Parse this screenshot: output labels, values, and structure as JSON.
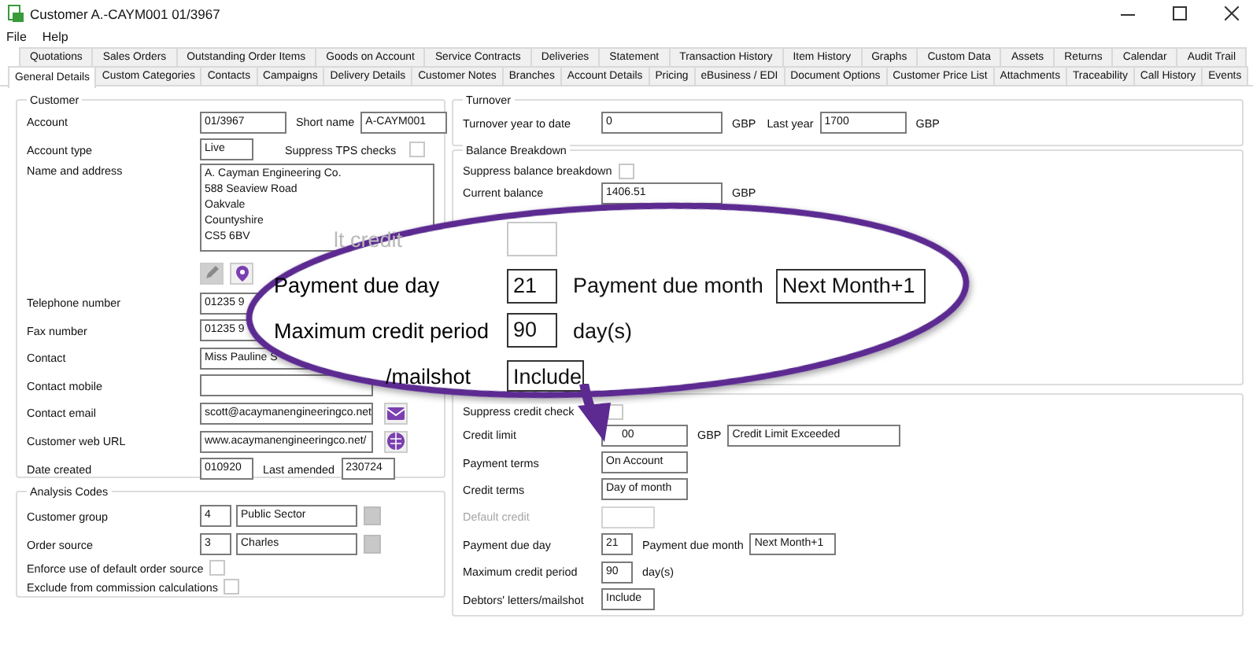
{
  "window": {
    "title": "Customer A.-CAYM001 01/3967"
  },
  "menu": [
    "File",
    "Help"
  ],
  "tab_rows": [
    [
      {
        "label": "Quotations",
        "selected": false
      },
      {
        "label": "Sales Orders",
        "selected": false
      },
      {
        "label": "Outstanding Order Items",
        "selected": false
      },
      {
        "label": "Goods on Account",
        "selected": false
      },
      {
        "label": "Service Contracts",
        "selected": false
      },
      {
        "label": "Deliveries",
        "selected": false
      },
      {
        "label": "Statement",
        "selected": false
      },
      {
        "label": "Transaction History",
        "selected": false
      },
      {
        "label": "Item History",
        "selected": false
      },
      {
        "label": "Graphs",
        "selected": false
      },
      {
        "label": "Custom Data",
        "selected": false
      },
      {
        "label": "Assets",
        "selected": false
      },
      {
        "label": "Returns",
        "selected": false
      },
      {
        "label": "Calendar",
        "selected": false
      },
      {
        "label": "Audit Trail",
        "selected": false
      }
    ],
    [
      {
        "label": "General Details",
        "selected": true
      },
      {
        "label": "Custom Categories",
        "selected": false
      },
      {
        "label": "Contacts",
        "selected": false
      },
      {
        "label": "Campaigns",
        "selected": false
      },
      {
        "label": "Delivery Details",
        "selected": false
      },
      {
        "label": "Customer Notes",
        "selected": false
      },
      {
        "label": "Branches",
        "selected": false
      },
      {
        "label": "Account Details",
        "selected": false
      },
      {
        "label": "Pricing",
        "selected": false
      },
      {
        "label": "eBusiness / EDI",
        "selected": false
      },
      {
        "label": "Document Options",
        "selected": false
      },
      {
        "label": "Customer Price List",
        "selected": false
      },
      {
        "label": "Attachments",
        "selected": false
      },
      {
        "label": "Traceability",
        "selected": false
      },
      {
        "label": "Call History",
        "selected": false
      },
      {
        "label": "Events",
        "selected": false
      }
    ]
  ],
  "customer": {
    "title": "Customer",
    "rows": [
      {
        "label": "Account",
        "items": [
          {
            "kind": "medium",
            "value": "01/3967"
          },
          {
            "kind": "text",
            "text": "Short name"
          },
          {
            "kind": "medium",
            "value": "A-CAYM001"
          }
        ]
      },
      {
        "label": "Account type",
        "items": [
          {
            "kind": "small",
            "value": "Live"
          },
          {
            "kind": "spacer"
          },
          {
            "kind": "text",
            "text": "Suppress TPS checks"
          },
          {
            "kind": "checkbox",
            "checked": false
          }
        ]
      },
      {
        "label": "Name and address",
        "items": [
          {
            "kind": "address",
            "lines": [
              "A. Cayman Engineering Co.",
              "588 Seaview Road",
              "Oakvale",
              "Countyshire",
              "CS5 6BV"
            ]
          }
        ]
      },
      {
        "kind": "tools",
        "items": []
      },
      {
        "label": "Telephone number",
        "items": [
          {
            "kind": "full",
            "value": "01235 9"
          }
        ]
      },
      {
        "label": "Fax number",
        "items": [
          {
            "kind": "full",
            "value": "01235 9"
          }
        ]
      },
      {
        "label": "Contact",
        "items": [
          {
            "kind": "full",
            "value": "Miss Pauline S"
          }
        ]
      },
      {
        "label": "Contact mobile",
        "items": [
          {
            "kind": "full"
          }
        ]
      },
      {
        "label": "Contact email",
        "items": [
          {
            "kind": "full",
            "value": "scott@acaymanengineeringco.net"
          },
          {
            "kind": "mail"
          }
        ]
      },
      {
        "label": "Customer web URL",
        "items": [
          {
            "kind": "full",
            "value": "www.acaymanengineeringco.net/"
          },
          {
            "kind": "web"
          }
        ]
      },
      {
        "label": "Date created",
        "items": [
          {
            "kind": "small",
            "value": "010920"
          },
          {
            "kind": "text",
            "text": "Last amended"
          },
          {
            "kind": "small",
            "value": "230724"
          }
        ]
      }
    ]
  },
  "analysis_codes": {
    "title": "Analysis Codes",
    "rows": [
      {
        "label": "Customer group",
        "items": [
          {
            "kind": "tiny",
            "value": "4"
          },
          {
            "kind": "long",
            "value": "Public Sector"
          },
          {
            "kind": "lookup"
          }
        ]
      },
      {
        "label": "Order source",
        "items": [
          {
            "kind": "tiny",
            "value": "3"
          },
          {
            "kind": "long",
            "value": "Charles"
          },
          {
            "kind": "lookup"
          }
        ]
      },
      {
        "label": "Enforce use of default order source",
        "items": [
          {
            "kind": "checkbox",
            "checked": false
          }
        ]
      },
      {
        "label": "Exclude from commission calculations",
        "items": [
          {
            "kind": "checkbox",
            "checked": false
          }
        ]
      }
    ]
  },
  "turnover": {
    "title": "Turnover",
    "rows": [
      {
        "label": "Turnover year to date",
        "items": [
          {
            "kind": "long",
            "value": "0"
          },
          {
            "kind": "text",
            "text": "GBP"
          },
          {
            "kind": "text",
            "text": "Last year"
          },
          {
            "kind": "medium",
            "value": "1700"
          },
          {
            "kind": "text",
            "text": "GBP"
          }
        ]
      }
    ]
  },
  "balance_breakdown": {
    "title": "Balance Breakdown",
    "rows": [
      {
        "label": "Suppress balance breakdown",
        "items": [
          {
            "kind": "checkbox",
            "checked": false
          }
        ]
      },
      {
        "label": "Current balance",
        "items": [
          {
            "kind": "long",
            "value": "1406.51"
          },
          {
            "kind": "text",
            "text": "GBP"
          }
        ]
      }
    ]
  },
  "credit": {
    "rows": [
      {
        "label": "Suppress credit check",
        "items": [
          {
            "kind": "checkbox",
            "checked": false
          }
        ]
      },
      {
        "label": "Credit limit",
        "items": [
          {
            "kind": "medium",
            "value": "00"
          },
          {
            "kind": "text",
            "text": "GBP"
          },
          {
            "kind": "full",
            "value": "Credit Limit Exceeded"
          }
        ]
      },
      {
        "label": "Payment terms",
        "items": [
          {
            "kind": "medium",
            "value": "On Account"
          }
        ]
      },
      {
        "label": "Credit terms",
        "items": [
          {
            "kind": "medium",
            "value": "Day of month"
          }
        ]
      },
      {
        "label": "Default credit",
        "disabled": true,
        "items": [
          {
            "kind": "small"
          }
        ]
      },
      {
        "label": "Payment due day",
        "items": [
          {
            "kind": "tiny",
            "value": "21"
          },
          {
            "kind": "text",
            "text": "Payment due month"
          },
          {
            "kind": "medium",
            "value": "Next Month+1"
          }
        ]
      },
      {
        "label": "Maximum credit period",
        "items": [
          {
            "kind": "tiny",
            "value": "90"
          },
          {
            "kind": "text",
            "text": "day(s)"
          }
        ]
      },
      {
        "label": "Debtors' letters/mailshot",
        "items": [
          {
            "kind": "small",
            "value": "Include"
          }
        ]
      }
    ]
  },
  "callout": {
    "rows": [
      {
        "label": "lt credit",
        "disabled": true,
        "items": [
          {
            "kind": "box"
          }
        ]
      },
      {
        "label": "Payment due day",
        "items": [
          {
            "kind": "num",
            "value": "21"
          },
          {
            "kind": "text",
            "text": "Payment due month"
          },
          {
            "kind": "wide",
            "value": "Next Month+1"
          }
        ]
      },
      {
        "label": "Maximum credit period",
        "items": [
          {
            "kind": "num",
            "value": "90"
          },
          {
            "kind": "text",
            "text": "day(s)"
          }
        ]
      },
      {
        "label": "/mailshot",
        "items": [
          {
            "kind": "mid",
            "value": "Include"
          }
        ]
      }
    ]
  }
}
